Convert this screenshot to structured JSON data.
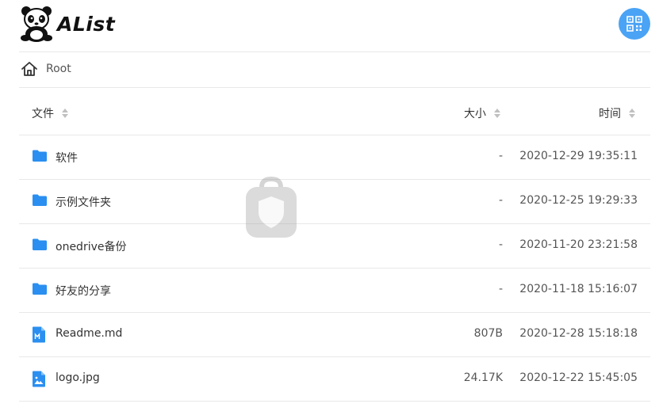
{
  "header": {
    "logo_text": "AList"
  },
  "breadcrumb": {
    "root_label": "Root"
  },
  "table": {
    "columns": {
      "name": "文件",
      "size": "大小",
      "time": "时间"
    },
    "rows": [
      {
        "icon": "folder-icon",
        "name": "软件",
        "size": "-",
        "time": "2020-12-29 19:35:11"
      },
      {
        "icon": "folder-icon",
        "name": "示例文件夹",
        "size": "-",
        "time": "2020-12-25 19:29:33"
      },
      {
        "icon": "folder-icon",
        "name": "onedrive备份",
        "size": "-",
        "time": "2020-11-20 23:21:58"
      },
      {
        "icon": "folder-icon",
        "name": "好友的分享",
        "size": "-",
        "time": "2020-11-18 15:16:07"
      },
      {
        "icon": "markdown-file-icon",
        "name": "Readme.md",
        "size": "807B",
        "time": "2020-12-28 15:18:18"
      },
      {
        "icon": "image-file-icon",
        "name": "logo.jpg",
        "size": "24.17K",
        "time": "2020-12-22 15:45:05"
      }
    ]
  },
  "colors": {
    "accent": "#4aa3f5",
    "folder": "#2a8ff0",
    "divider": "#e8e8e8"
  }
}
